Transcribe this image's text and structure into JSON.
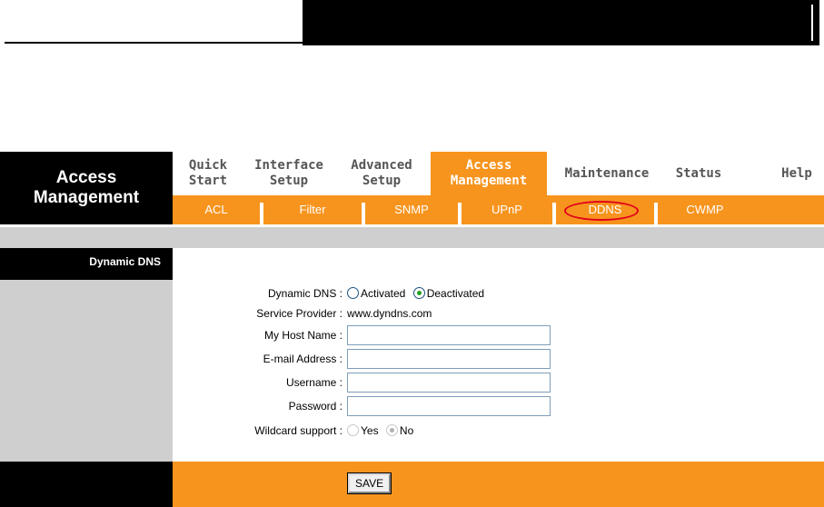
{
  "header": {
    "title_line1": "Access",
    "title_line2": "Management"
  },
  "nav": [
    {
      "label": "Quick\nStart",
      "active": false
    },
    {
      "label": "Interface\nSetup",
      "active": false
    },
    {
      "label": "Advanced\nSetup",
      "active": false
    },
    {
      "label": "Access\nManagement",
      "active": true
    },
    {
      "label": "Maintenance",
      "active": false
    },
    {
      "label": "Status",
      "active": false
    },
    {
      "label": "Help",
      "active": false
    }
  ],
  "subnav": [
    {
      "label": "ACL"
    },
    {
      "label": "Filter"
    },
    {
      "label": "SNMP"
    },
    {
      "label": "UPnP"
    },
    {
      "label": "DDNS",
      "selected": true
    },
    {
      "label": "CWMP"
    }
  ],
  "section": {
    "title": "Dynamic DNS"
  },
  "form": {
    "dynamic_dns": {
      "label": "Dynamic DNS :",
      "options": [
        "Activated",
        "Deactivated"
      ],
      "selected": "Deactivated"
    },
    "service_provider": {
      "label": "Service Provider :",
      "value": "www.dyndns.com"
    },
    "host_name": {
      "label": "My Host Name :",
      "value": ""
    },
    "email": {
      "label": "E-mail Address :",
      "value": ""
    },
    "username": {
      "label": "Username :",
      "value": ""
    },
    "password": {
      "label": "Password :",
      "value": ""
    },
    "wildcard": {
      "label": "Wildcard support :",
      "options": [
        "Yes",
        "No"
      ],
      "selected": "No"
    }
  },
  "footer": {
    "save_label": "SAVE"
  },
  "colors": {
    "accent": "#f7941e",
    "highlight": "#e0001a"
  }
}
